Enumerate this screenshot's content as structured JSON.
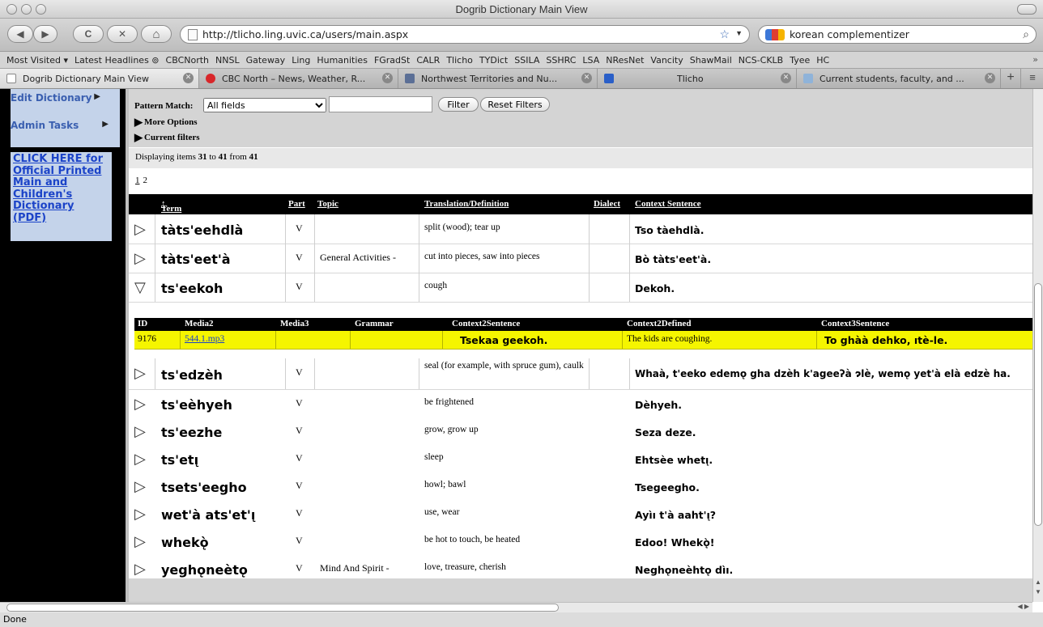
{
  "window": {
    "title": "Dogrib Dictionary Main View"
  },
  "toolbar": {
    "back": "◀",
    "forward": "▶",
    "reload": "C",
    "stop": "✕",
    "home": "⌂",
    "url": "http://tlicho.ling.uvic.ca/users/main.aspx",
    "search_value": "korean complementizer"
  },
  "bookmarks": [
    "Most Visited ▾",
    "Latest Headlines ⊚",
    "CBCNorth",
    "NNSL",
    "Gateway",
    "Ling",
    "Humanities",
    "FGradSt",
    "CALR",
    "Tlicho",
    "TYDict",
    "SSILA",
    "SSHRC",
    "LSA",
    "NResNet",
    "Vancity",
    "ShawMail",
    "NCS-CKLB",
    "Tyee",
    "HC"
  ],
  "bookmarks_more": "»",
  "tabs": [
    {
      "label": "Dogrib Dictionary Main View",
      "active": true,
      "icon_color": "#ffffff"
    },
    {
      "label": "CBC North – News, Weather, R...",
      "active": false,
      "icon_color": "#d8262a"
    },
    {
      "label": "Northwest Territories and Nu...",
      "active": false,
      "icon_color": "#5b6f96"
    },
    {
      "label": "Tlicho",
      "active": false,
      "icon_color": "#2a5fc8"
    },
    {
      "label": "Current students, faculty, and ...",
      "active": false,
      "icon_color": "#8fb3d9"
    }
  ],
  "sidebar": {
    "edit_dictionary": "Edit Dictionary",
    "admin_tasks": "Admin Tasks",
    "pdf_link": "CLICK HERE for Official Printed Main and Children's Dictionary (PDF)"
  },
  "filter": {
    "pattern_label": "Pattern Match:",
    "pattern_value": "All fields",
    "filter_btn": "Filter",
    "reset_btn": "Reset Filters",
    "more_options": "More Options",
    "current_filters": "Current filters"
  },
  "displaying": {
    "prefix": "Displaying items",
    "from": "31",
    "to_word": "to",
    "to": "41",
    "from_word": "from",
    "total": "41"
  },
  "pages": [
    "1",
    "2"
  ],
  "columns": {
    "term": "Term",
    "term_sort": "↑",
    "part": "Part",
    "topic": "Topic",
    "translation": "Translation/Definition",
    "dialect": "Dialect",
    "context": "Context Sentence"
  },
  "rows": [
    {
      "expanded": false,
      "term": "tàts'eehdlà",
      "part": "V",
      "topic": "",
      "translation": "split (wood); tear up",
      "dialect": "",
      "context": "Tso tàehdlà."
    },
    {
      "expanded": false,
      "term": "tàts'eet'à",
      "part": "V",
      "topic": "General Activities -",
      "translation": "cut into pieces, saw into pieces",
      "dialect": "",
      "context": "Bò tàts'eet'à."
    },
    {
      "expanded": true,
      "term": "ts'eekoh",
      "part": "V",
      "topic": "",
      "translation": "cough",
      "dialect": "",
      "context": "Dekoh."
    },
    {
      "expanded": false,
      "term": "ts'edzèh",
      "part": "V",
      "topic": "",
      "translation": "seal (for example, with spruce gum), caulk",
      "dialect": "",
      "context": "Whaà, t'eeko edemǫ gha dzèh k'ageeʔà ɂlè, wemǫ yet'à elà edzè ha."
    },
    {
      "expanded": false,
      "term": "ts'eèhyeh",
      "part": "V",
      "topic": "",
      "translation": "be frightened",
      "dialect": "",
      "context": "Dèhyeh."
    },
    {
      "expanded": false,
      "term": "ts'eezhe",
      "part": "V",
      "topic": "",
      "translation": "grow, grow up",
      "dialect": "",
      "context": "Seza deze."
    },
    {
      "expanded": false,
      "term": "ts'etı̨",
      "part": "V",
      "topic": "",
      "translation": "sleep",
      "dialect": "",
      "context": "Ehtsèe whetı̨."
    },
    {
      "expanded": false,
      "term": "tsets'eegho",
      "part": "V",
      "topic": "",
      "translation": "howl; bawl",
      "dialect": "",
      "context": "Tsegeegho."
    },
    {
      "expanded": false,
      "term": "wet'à ats'et'ı̨",
      "part": "V",
      "topic": "",
      "translation": "use, wear",
      "dialect": "",
      "context": "Ayìı t'à aaht'ı̨?"
    },
    {
      "expanded": false,
      "term": "whekǫ̀",
      "part": "V",
      "topic": "",
      "translation": "be hot to touch, be heated",
      "dialect": "",
      "context": "Edoo! Whekǫ̀!"
    },
    {
      "expanded": false,
      "term": "yeghǫneètǫ",
      "part": "V",
      "topic": "Mind And Spirit -",
      "translation": "love, treasure, cherish",
      "dialect": "",
      "context": "Neghǫneèhtǫ dìı."
    }
  ],
  "detail": {
    "headers": [
      "ID",
      "Media2",
      "Media3",
      "Grammar",
      "Context2Sentence",
      "Context2Defined",
      "Context3Sentence"
    ],
    "id": "9176",
    "media2": "544.1.mp3",
    "media3": "",
    "grammar": "",
    "context2_sentence": "Tsekaa geekoh.",
    "context2_defined": "The kids are coughing.",
    "context3_sentence": "To ghàà dehko, ıtè-le."
  },
  "status": "Done"
}
